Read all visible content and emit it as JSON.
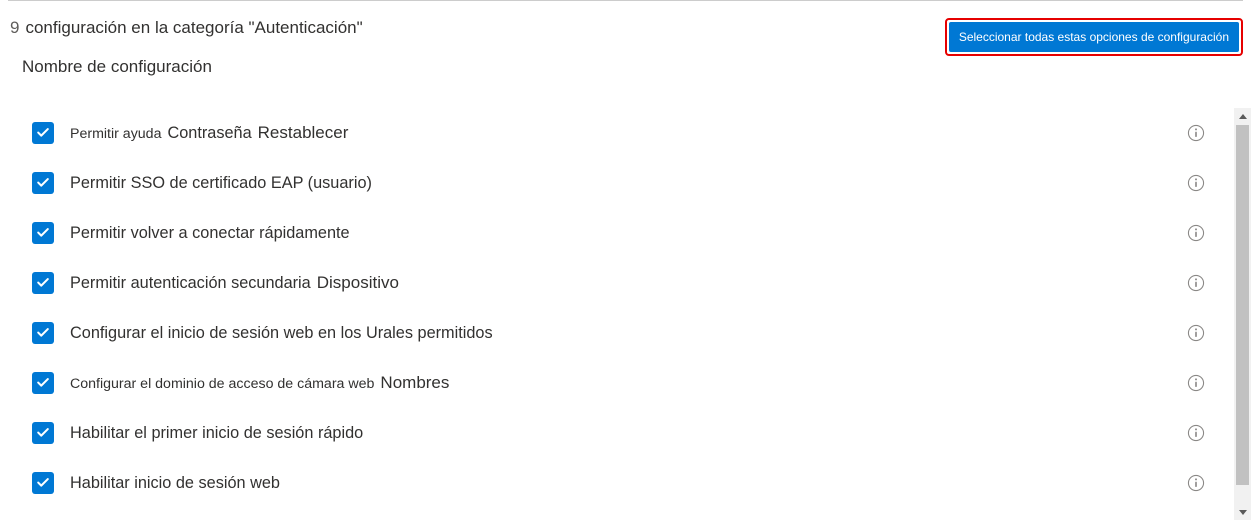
{
  "header": {
    "count": "9",
    "title": "configuración en la categoría \"Autenticación\"",
    "select_all_label": "Seleccionar todas estas opciones de configuración"
  },
  "column_header": "Nombre de configuración",
  "accent_color": "#0078d4",
  "settings": [
    {
      "checked": true,
      "small": true,
      "seg1": "Permitir ayuda",
      "seg2": "Contraseña",
      "seg3": "Restablecer"
    },
    {
      "checked": true,
      "small": false,
      "seg1": "Permitir SSO de certificado EAP (usuario)",
      "seg2": "",
      "seg3": ""
    },
    {
      "checked": true,
      "small": false,
      "seg1": "Permitir volver a conectar rápidamente",
      "seg2": "",
      "seg3": ""
    },
    {
      "checked": true,
      "small": false,
      "seg1": "Permitir autenticación secundaria",
      "seg2": "",
      "seg3": "Dispositivo"
    },
    {
      "checked": true,
      "small": false,
      "seg1": "Configurar el inicio de sesión web en los Urales permitidos",
      "seg2": "",
      "seg3": ""
    },
    {
      "checked": true,
      "small": true,
      "seg1": "Configurar el dominio de acceso de cámara web",
      "seg2": "",
      "seg3": "Nombres"
    },
    {
      "checked": true,
      "small": false,
      "seg1": "Habilitar el primer inicio de sesión rápido",
      "seg2": "",
      "seg3": ""
    },
    {
      "checked": true,
      "small": false,
      "seg1": "Habilitar inicio de sesión web",
      "seg2": "",
      "seg3": ""
    }
  ]
}
